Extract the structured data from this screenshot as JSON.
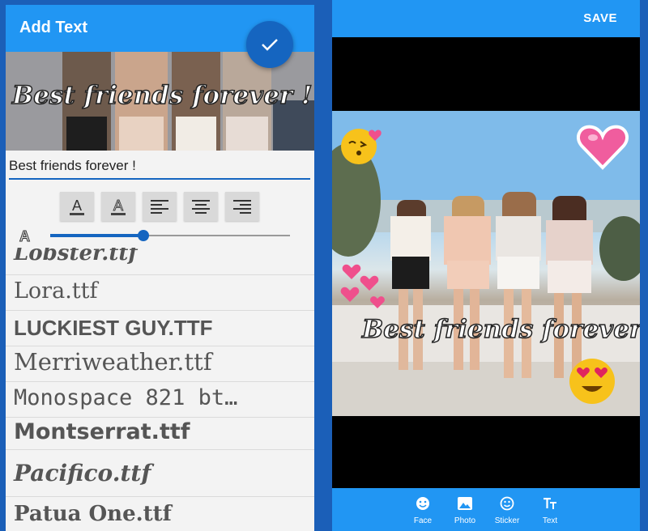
{
  "left": {
    "title": "Add Text",
    "preview_text": "Best friends forever !",
    "input_value": "Best friends forever !",
    "format_buttons": [
      {
        "name": "text-color",
        "glyph": "A"
      },
      {
        "name": "text-outline",
        "glyph": "A"
      },
      {
        "name": "align-left",
        "icon": "align-left-icon"
      },
      {
        "name": "align-center",
        "icon": "align-center-icon"
      },
      {
        "name": "align-right",
        "icon": "align-right-icon"
      }
    ],
    "size_slider": {
      "icon": "A",
      "value": 0.39
    },
    "fonts": [
      "Lobster.ttf",
      "Lora.ttf",
      "LUCKIEST GUY.TTF",
      "Merriweather.ttf",
      "Monospace 821 bt…",
      "Montserrat.ttf",
      "Pacifico.ttf",
      "Patua One.ttf"
    ]
  },
  "right": {
    "save_label": "SAVE",
    "photo_text": "Best friends forever !",
    "stickers": [
      "kiss-emoji",
      "pink-heart",
      "hearts-cluster",
      "heart-eyes-emoji"
    ],
    "tools": [
      {
        "label": "Face",
        "icon": "face-icon"
      },
      {
        "label": "Photo",
        "icon": "photo-icon"
      },
      {
        "label": "Sticker",
        "icon": "sticker-icon"
      },
      {
        "label": "Text",
        "icon": "text-icon"
      }
    ]
  },
  "colors": {
    "primary": "#2196f3",
    "primary_dark": "#1565c0",
    "background": "#1b5fb8"
  }
}
